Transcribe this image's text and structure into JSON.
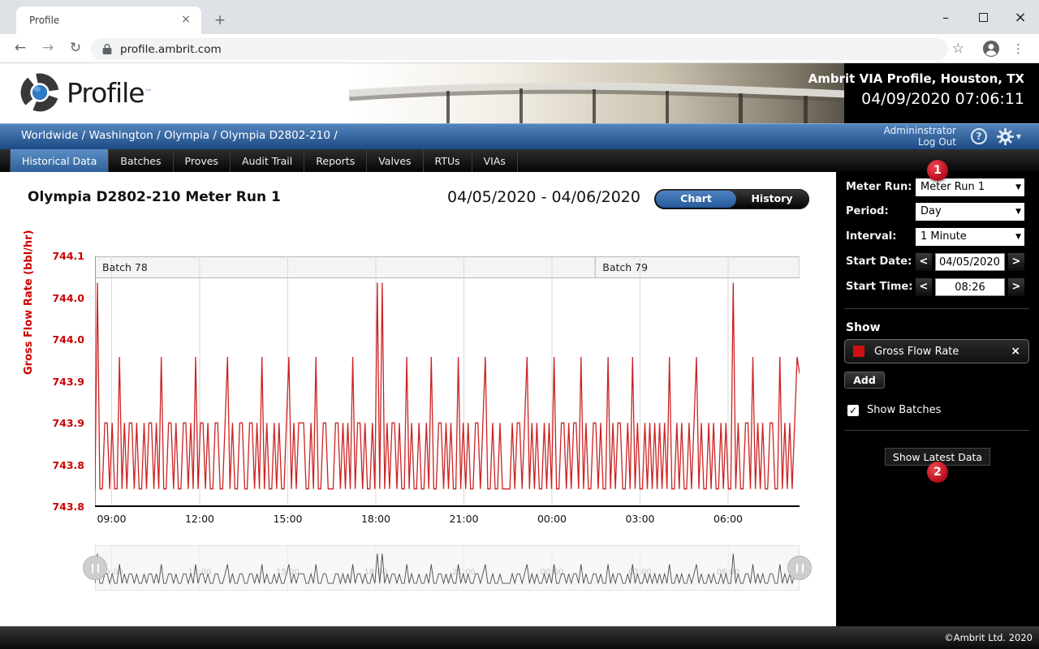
{
  "browser": {
    "tab_title": "Profile",
    "url": "profile.ambrit.com",
    "icons": {
      "back": "←",
      "forward": "→",
      "reload": "↻",
      "star": "☆",
      "menu": "⋮",
      "tab_close": "×",
      "new_tab": "+",
      "minimize": "–",
      "close": "×"
    }
  },
  "header": {
    "logo_text": "Profile",
    "logo_tm": "™",
    "location_title": "Ambrit VIA Profile, Houston, TX",
    "datetime": "04/09/2020 07:06:11"
  },
  "breadcrumb": {
    "path": "Worldwide / Washington / Olympia / Olympia D2802-210 /",
    "user": "Admininstrator",
    "logout": "Log Out",
    "help_glyph": "?",
    "gear_caret": "▼"
  },
  "nav": {
    "tabs": [
      {
        "label": "Historical Data",
        "active": true
      },
      {
        "label": "Batches",
        "active": false
      },
      {
        "label": "Proves",
        "active": false
      },
      {
        "label": "Audit Trail",
        "active": false
      },
      {
        "label": "Reports",
        "active": false
      },
      {
        "label": "Valves",
        "active": false
      },
      {
        "label": "RTUs",
        "active": false
      },
      {
        "label": "VIAs",
        "active": false
      }
    ]
  },
  "chart_header": {
    "title": "Olympia D2802-210 Meter Run 1",
    "date_range": "04/05/2020 - 04/06/2020",
    "toggle": {
      "chart": "Chart",
      "history": "History",
      "active": "Chart"
    }
  },
  "sidebar": {
    "meter_run_label": "Meter Run:",
    "meter_run_value": "Meter Run 1",
    "period_label": "Period:",
    "period_value": "Day",
    "interval_label": "Interval:",
    "interval_value": "1 Minute",
    "start_date_label": "Start Date:",
    "start_date_value": "04/05/2020",
    "start_time_label": "Start Time:",
    "start_time_value": "08:26",
    "prev_glyph": "<",
    "next_glyph": ">",
    "select_arrow": "▼",
    "show_heading": "Show",
    "legend_item": "Gross Flow Rate",
    "legend_color": "#cc1111",
    "remove_glyph": "×",
    "add_button": "Add",
    "check_glyph": "✓",
    "show_batches_label": "Show Batches",
    "show_batches_checked": true,
    "show_latest_button": "Show Latest Data",
    "badge1": "1",
    "badge2": "2"
  },
  "footer": {
    "copyright": "©Ambrit Ltd. 2020"
  },
  "chart_data": {
    "type": "line",
    "title": "Olympia D2802-210 Meter Run 1",
    "date_range": "04/05/2020 - 04/06/2020",
    "xlabel": "",
    "ylabel": "Gross Flow Rate (bbl/hr)",
    "ylim": [
      743.8,
      744.1
    ],
    "grid": "vertical-only",
    "y_ticks": [
      {
        "value": 744.1,
        "label": "744.1"
      },
      {
        "value": 744.05,
        "label": "744.0"
      },
      {
        "value": 744.0,
        "label": "744.0"
      },
      {
        "value": 743.95,
        "label": "743.9"
      },
      {
        "value": 743.9,
        "label": "743.9"
      },
      {
        "value": 743.85,
        "label": "743.8"
      },
      {
        "value": 743.8,
        "label": "743.8"
      }
    ],
    "x_ticks": [
      {
        "fraction": 0.0236,
        "label": "09:00"
      },
      {
        "fraction": 0.1486,
        "label": "12:00"
      },
      {
        "fraction": 0.2736,
        "label": "15:00"
      },
      {
        "fraction": 0.3986,
        "label": "18:00"
      },
      {
        "fraction": 0.5236,
        "label": "21:00"
      },
      {
        "fraction": 0.6486,
        "label": "00:00"
      },
      {
        "fraction": 0.7736,
        "label": "03:00"
      },
      {
        "fraction": 0.8986,
        "label": "06:00"
      }
    ],
    "batches": [
      {
        "label": "Batch 78",
        "start": 0.0,
        "end": 0.71
      },
      {
        "label": "Batch 79",
        "start": 0.71,
        "end": 1.0
      }
    ],
    "series": [
      {
        "name": "Gross Flow Rate",
        "color": "#cc2222",
        "values": [
          743.82,
          744.07,
          743.82,
          743.82,
          743.9,
          743.9,
          743.82,
          743.9,
          743.82,
          743.82,
          743.98,
          743.82,
          743.9,
          743.82,
          743.9,
          743.9,
          743.82,
          743.9,
          743.82,
          743.82,
          743.9,
          743.82,
          743.9,
          743.9,
          743.82,
          743.9,
          743.82,
          743.98,
          743.82,
          743.82,
          743.9,
          743.9,
          743.82,
          743.9,
          743.82,
          743.82,
          743.9,
          743.9,
          743.82,
          743.9,
          743.82,
          743.98,
          743.82,
          743.9,
          743.9,
          743.82,
          743.9,
          743.82,
          743.82,
          743.9,
          743.9,
          743.82,
          743.82,
          743.9,
          743.98,
          743.82,
          743.9,
          743.82,
          743.82,
          743.9,
          743.9,
          743.82,
          743.82,
          743.9,
          743.9,
          743.82,
          743.9,
          743.82,
          743.98,
          743.82,
          743.9,
          743.82,
          743.82,
          743.9,
          743.82,
          743.9,
          743.82,
          743.82,
          743.9,
          743.98,
          743.82,
          743.9,
          743.82,
          743.9,
          743.9,
          743.9,
          743.82,
          743.82,
          743.9,
          743.82,
          743.98,
          743.82,
          743.82,
          743.9,
          743.9,
          743.82,
          743.82,
          743.82,
          743.9,
          743.9,
          743.82,
          743.9,
          743.82,
          743.9,
          743.82,
          743.98,
          743.82,
          743.9,
          743.9,
          743.82,
          743.9,
          743.82,
          743.82,
          743.9,
          743.82,
          744.07,
          743.82,
          744.07,
          743.82,
          743.9,
          743.82,
          743.9,
          743.9,
          743.82,
          743.9,
          743.82,
          743.82,
          743.98,
          743.82,
          743.9,
          743.82,
          743.82,
          743.9,
          743.82,
          743.82,
          743.9,
          743.82,
          743.98,
          743.82,
          743.82,
          743.9,
          743.9,
          743.82,
          743.9,
          743.82,
          743.9,
          743.82,
          743.82,
          743.98,
          743.82,
          743.9,
          743.82,
          743.9,
          743.82,
          743.82,
          743.9,
          743.9,
          743.82,
          743.9,
          743.98,
          743.82,
          743.82,
          743.9,
          743.82,
          743.82,
          743.9,
          743.82,
          743.82,
          743.82,
          743.82,
          743.9,
          743.82,
          743.9,
          743.9,
          743.82,
          743.9,
          743.98,
          743.82,
          743.9,
          743.82,
          743.9,
          743.82,
          743.82,
          743.9,
          743.82,
          743.9,
          743.82,
          743.98,
          743.82,
          743.82,
          743.9,
          743.9,
          743.82,
          743.9,
          743.82,
          743.9,
          743.9,
          743.82,
          743.98,
          743.82,
          743.9,
          743.82,
          743.82,
          743.9,
          743.9,
          743.82,
          743.9,
          743.82,
          743.82,
          743.98,
          743.82,
          743.9,
          743.82,
          743.9,
          743.9,
          743.82,
          743.82,
          743.9,
          743.82,
          743.98,
          743.82,
          743.9,
          743.82,
          743.82,
          743.9,
          743.82,
          743.9,
          743.82,
          743.9,
          743.82,
          743.9,
          743.82,
          743.9,
          743.82,
          743.98,
          743.82,
          743.82,
          743.9,
          743.82,
          743.9,
          743.82,
          743.82,
          743.9,
          743.82,
          743.9,
          743.98,
          743.82,
          743.9,
          743.82,
          743.82,
          743.9,
          743.82,
          743.9,
          743.82,
          743.82,
          743.9,
          743.82,
          743.9,
          743.82,
          743.82,
          744.07,
          743.82,
          743.9,
          743.82,
          743.82,
          743.9,
          743.9,
          743.82,
          743.98,
          743.82,
          743.9,
          743.82,
          743.9,
          743.82,
          743.82,
          743.9,
          743.9,
          743.82,
          743.82,
          743.98,
          743.82,
          743.9,
          743.82,
          743.9,
          743.82,
          743.9,
          743.98,
          743.96
        ]
      }
    ],
    "navigator": {
      "present": true,
      "series_color": "#4a4a4a",
      "background": "#f7f7f7"
    }
  }
}
